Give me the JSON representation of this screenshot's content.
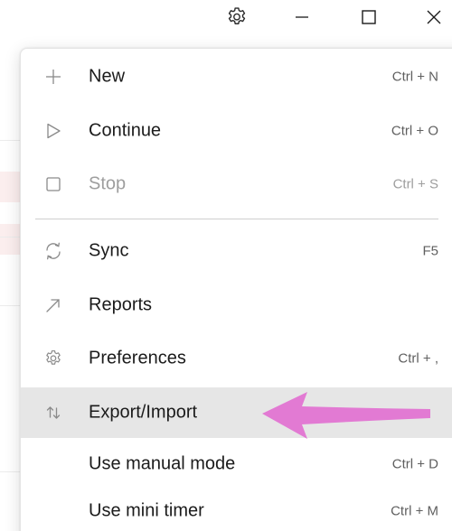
{
  "window": {
    "settings_icon": "gear-icon",
    "minimize_icon": "minimize-icon",
    "maximize_icon": "maximize-icon",
    "close_icon": "close-icon"
  },
  "menu": {
    "items": [
      {
        "label": "New",
        "shortcut": "Ctrl + N",
        "icon": "plus-icon",
        "enabled": true
      },
      {
        "label": "Continue",
        "shortcut": "Ctrl + O",
        "icon": "play-icon",
        "enabled": true
      },
      {
        "label": "Stop",
        "shortcut": "Ctrl + S",
        "icon": "stop-icon",
        "enabled": false
      },
      {
        "label": "Sync",
        "shortcut": "F5",
        "icon": "sync-icon",
        "enabled": true
      },
      {
        "label": "Reports",
        "shortcut": "",
        "icon": "arrow-up-right-icon",
        "enabled": true
      },
      {
        "label": "Preferences",
        "shortcut": "Ctrl + ,",
        "icon": "gear-icon",
        "enabled": true
      },
      {
        "label": "Export/Import",
        "shortcut": "",
        "icon": "export-import-icon",
        "enabled": true,
        "highlighted": true
      },
      {
        "label": "Use manual mode",
        "shortcut": "Ctrl + D",
        "icon": "",
        "enabled": true
      },
      {
        "label": "Use mini timer",
        "shortcut": "Ctrl + M",
        "icon": "",
        "enabled": true
      }
    ]
  },
  "annotation": {
    "color": "#e27ad3",
    "points_to": "Export/Import"
  },
  "colors": {
    "highlight": "#e6e6e6",
    "disabled_text": "#9e9e9e",
    "icon_gray": "#8a8a8a"
  }
}
